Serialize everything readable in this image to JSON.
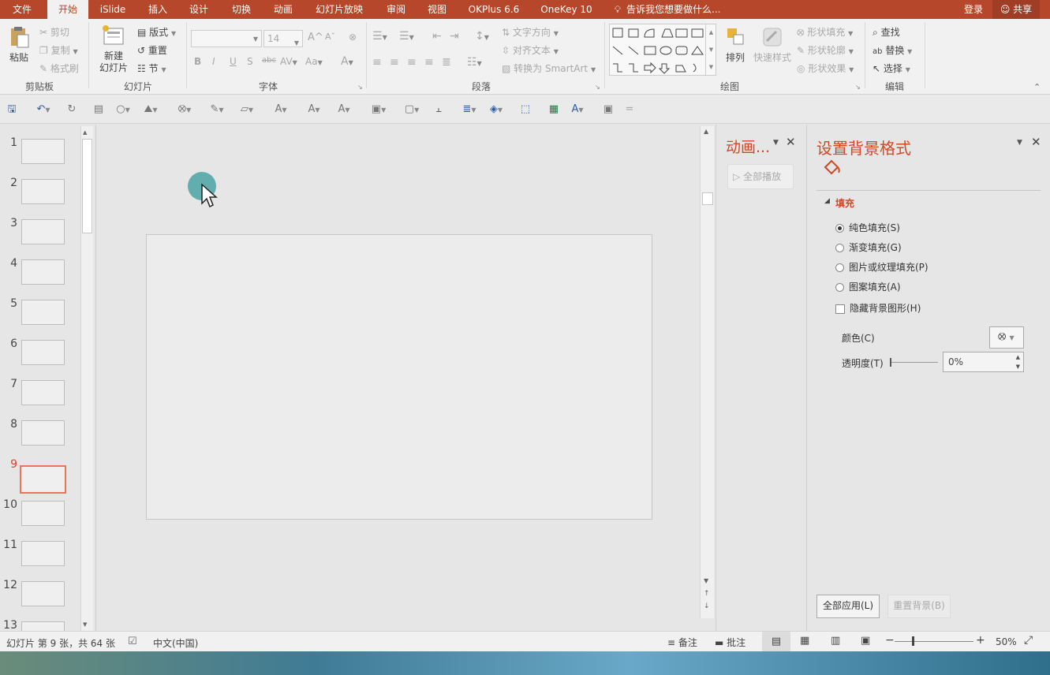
{
  "tabs": [
    "文件",
    "开始",
    "iSlide",
    "插入",
    "设计",
    "切换",
    "动画",
    "幻灯片放映",
    "审阅",
    "视图",
    "OKPlus 6.6",
    "OneKey 10"
  ],
  "tell_me": "告诉我您想要做什么...",
  "login": "登录",
  "share": "共享",
  "clipboard": {
    "paste": "粘贴",
    "cut": "剪切",
    "copy": "复制",
    "format_painter": "格式刷",
    "label": "剪贴板"
  },
  "slides_group": {
    "new_slide_line1": "新建",
    "new_slide_line2": "幻灯片",
    "layout": "版式",
    "reset": "重置",
    "section": "节",
    "label": "幻灯片"
  },
  "font_group": {
    "font_size": "14",
    "label": "字体",
    "bold": "B",
    "italic": "I",
    "underline": "U",
    "shadow": "S",
    "strike": "abc",
    "spacing": "AV",
    "case": "Aa",
    "color": "A",
    "grow": "A",
    "shrink": "A"
  },
  "paragraph_group": {
    "text_direction": "文字方向",
    "align_text": "对齐文本",
    "smartart": "转换为 SmartArt",
    "label": "段落"
  },
  "drawing_group": {
    "arrange": "排列",
    "quick_styles": "快速样式",
    "shape_fill": "形状填充",
    "shape_outline": "形状轮廓",
    "shape_effects": "形状效果",
    "label": "绘图"
  },
  "editing_group": {
    "find": "查找",
    "replace": "替换",
    "select": "选择",
    "label": "编辑"
  },
  "slides": [
    "1",
    "2",
    "3",
    "4",
    "5",
    "6",
    "7",
    "8",
    "9",
    "10",
    "11",
    "12",
    "13"
  ],
  "selected_slide": "9",
  "anim_pane": {
    "title": "动画...",
    "play_all": "全部播放"
  },
  "bg_pane": {
    "title": "设置背景格式",
    "section": "填充",
    "options": [
      "纯色填充(S)",
      "渐变填充(G)",
      "图片或纹理填充(P)",
      "图案填充(A)"
    ],
    "selected_option": "纯色填充(S)",
    "hide_bg": "隐藏背景图形(H)",
    "color_label": "颜色(C)",
    "transparency_label": "透明度(T)",
    "transparency_value": "0%",
    "apply_all": "全部应用(L)",
    "reset_bg": "重置背景(B)"
  },
  "status": {
    "slide_info": "幻灯片 第 9 张，共 64 张",
    "language": "中文(中国)",
    "notes": "备注",
    "comments": "批注",
    "zoom": "50%"
  },
  "colors": {
    "accent": "#b7472a",
    "pane_title": "#d24726",
    "selection": "#e8755a"
  }
}
